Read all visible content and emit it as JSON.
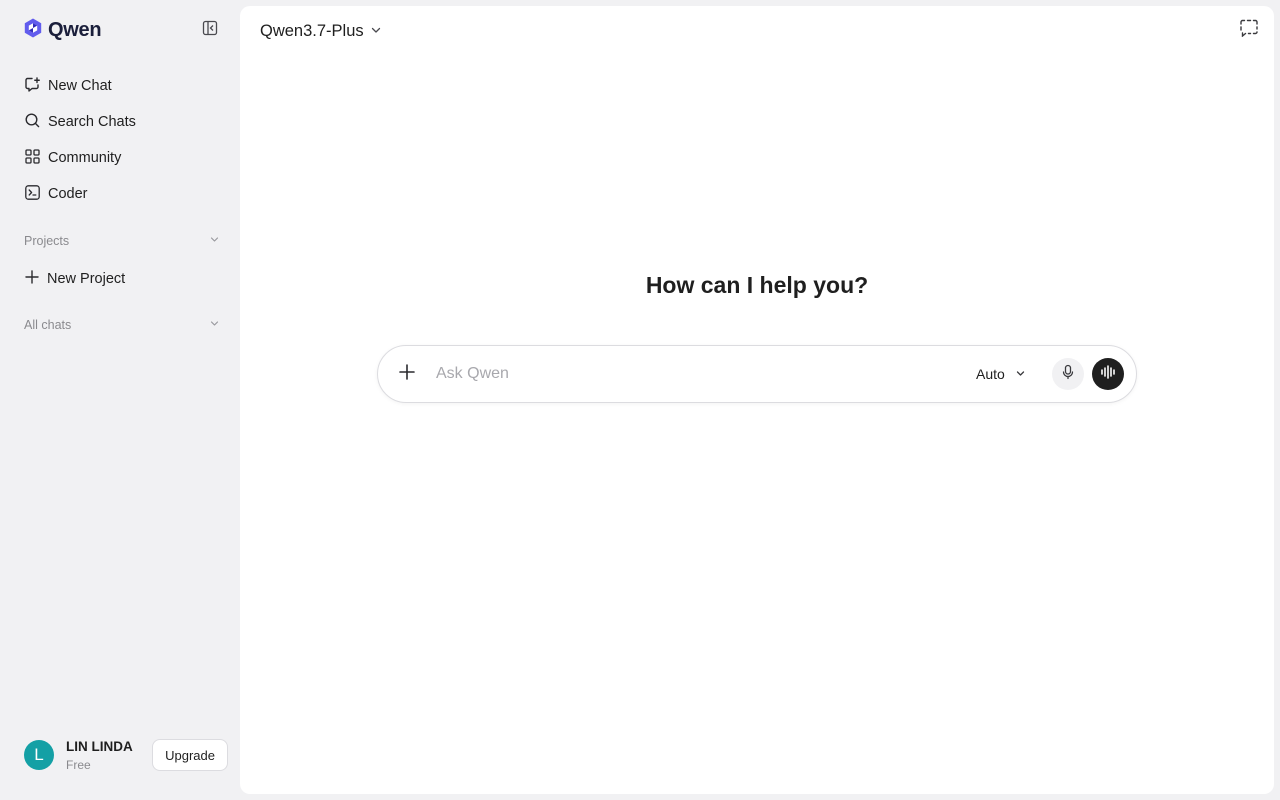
{
  "brand": {
    "name": "Qwen",
    "logo_icon": "qwen-logo-icon",
    "logo_color": "#615ced"
  },
  "sidebar": {
    "collapse_icon": "sidebar-collapse-icon",
    "items": [
      {
        "label": "New Chat",
        "icon": "new-chat-icon"
      },
      {
        "label": "Search Chats",
        "icon": "search-icon"
      },
      {
        "label": "Community",
        "icon": "grid-icon"
      },
      {
        "label": "Coder",
        "icon": "terminal-icon"
      }
    ],
    "projects_label": "Projects",
    "new_project_label": "New Project",
    "all_chats_label": "All chats"
  },
  "user": {
    "initial": "L",
    "name": "LIN LINDA",
    "plan": "Free",
    "upgrade_label": "Upgrade",
    "avatar_color": "#14a0a5"
  },
  "header": {
    "model_name": "Qwen3.7-Plus"
  },
  "main": {
    "greeting": "How can I help you?",
    "input_placeholder": "Ask Qwen",
    "mode_label": "Auto"
  }
}
